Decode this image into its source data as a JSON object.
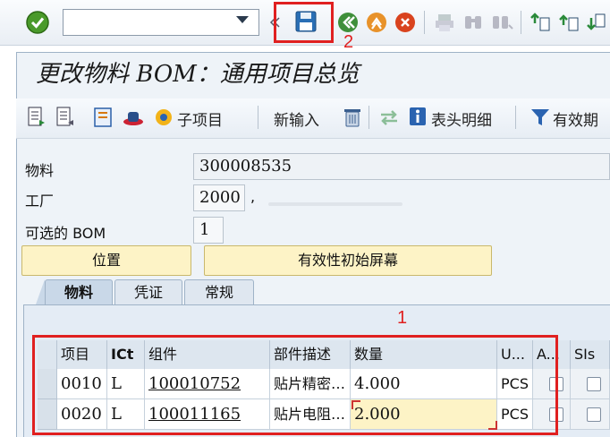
{
  "toolbar": {
    "command_value": "",
    "save_annotation": "2"
  },
  "screen": {
    "title": "更改物料 BOM：通用项目总览"
  },
  "app_toolbar": {
    "subitems_label": "子项目",
    "new_entries_label": "新输入",
    "header_label": "表头明细",
    "validity_label": "有效期"
  },
  "header_fields": {
    "material_label": "物料",
    "material_value": "300008535",
    "plant_label": "工厂",
    "plant_value": "2000",
    "plant_suffix": ",",
    "alt_bom_label": "可选的 BOM",
    "alt_bom_value": "1"
  },
  "buttons": {
    "position": "位置",
    "validity_initial": "有效性初始屏幕"
  },
  "tabs": [
    {
      "label": "物料",
      "active": true
    },
    {
      "label": "凭证",
      "active": false
    },
    {
      "label": "常规",
      "active": false
    }
  ],
  "table_annotation": "1",
  "table": {
    "columns": [
      "项目",
      "ICt",
      "组件",
      "部件描述",
      "数量",
      "U...",
      "A...",
      "SIs"
    ],
    "rows": [
      {
        "item": "0010",
        "ict": "L",
        "component": "100010752",
        "description": "贴片精密…",
        "quantity": "4.000",
        "unit": "PCS"
      },
      {
        "item": "0020",
        "ict": "L",
        "component": "100011165",
        "description": "贴片电阻…",
        "quantity": "2.000",
        "unit": "PCS"
      }
    ]
  },
  "colors": {
    "annotation_red": "#e02020",
    "highlight_yellow": "#fdf3c6"
  }
}
